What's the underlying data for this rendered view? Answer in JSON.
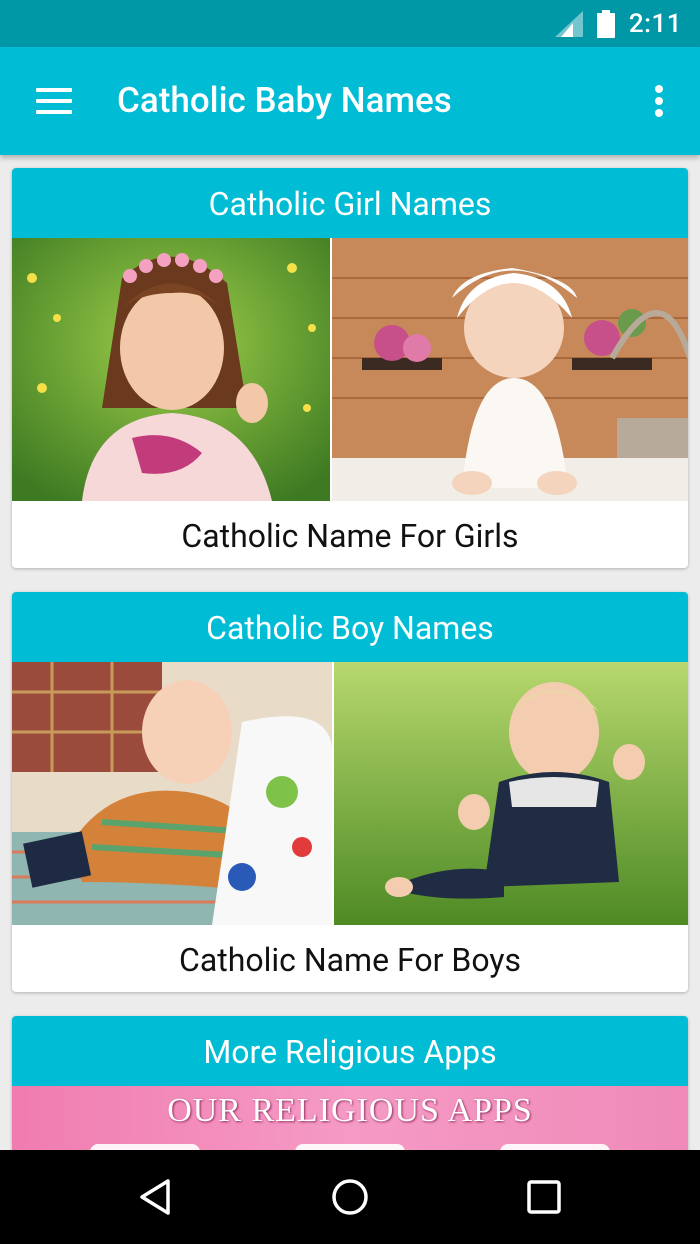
{
  "status_bar": {
    "time": "2:11",
    "icons": [
      "signal-icon",
      "battery-icon"
    ]
  },
  "app_bar": {
    "title": "Catholic Baby Names",
    "menu_icon": "hamburger-menu-icon",
    "overflow_icon": "more-vert-icon"
  },
  "cards": [
    {
      "header": "Catholic Girl Names",
      "caption": "Catholic Name For Girls"
    },
    {
      "header": "Catholic Boy Names",
      "caption": "Catholic Name For Boys"
    },
    {
      "header": "More Religious Apps",
      "banner_text": "OUR RELIGIOUS APPS"
    }
  ],
  "nav_bar": {
    "buttons": [
      "back-icon",
      "home-icon",
      "recents-icon"
    ]
  },
  "colors": {
    "status_bar": "#0097a7",
    "primary": "#00bcd4",
    "background": "#ececec"
  }
}
